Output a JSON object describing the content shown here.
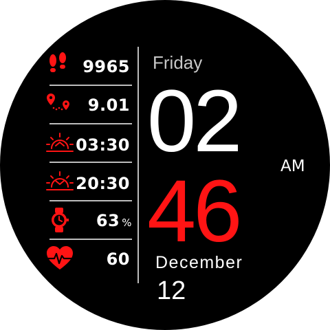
{
  "colors": {
    "accent": "#ff1414",
    "text": "#ffffff",
    "muted": "#c8c8c8",
    "divider": "#bdbdbd",
    "background": "#000000"
  },
  "stats": [
    {
      "icon": "footsteps-icon",
      "value": "9965",
      "unit": ""
    },
    {
      "icon": "route-distance-icon",
      "value": "9.01",
      "unit": ""
    },
    {
      "icon": "sunrise-icon",
      "value": "03:30",
      "unit": ""
    },
    {
      "icon": "sunset-icon",
      "value": "20:30",
      "unit": ""
    },
    {
      "icon": "watch-battery-icon",
      "value": "63",
      "unit": "%"
    },
    {
      "icon": "heart-rate-icon",
      "value": "60",
      "unit": ""
    }
  ],
  "time": {
    "day": "Friday",
    "hour": "02",
    "minute": "46",
    "ampm": "AM"
  },
  "date": {
    "month": "December",
    "day": "12"
  }
}
